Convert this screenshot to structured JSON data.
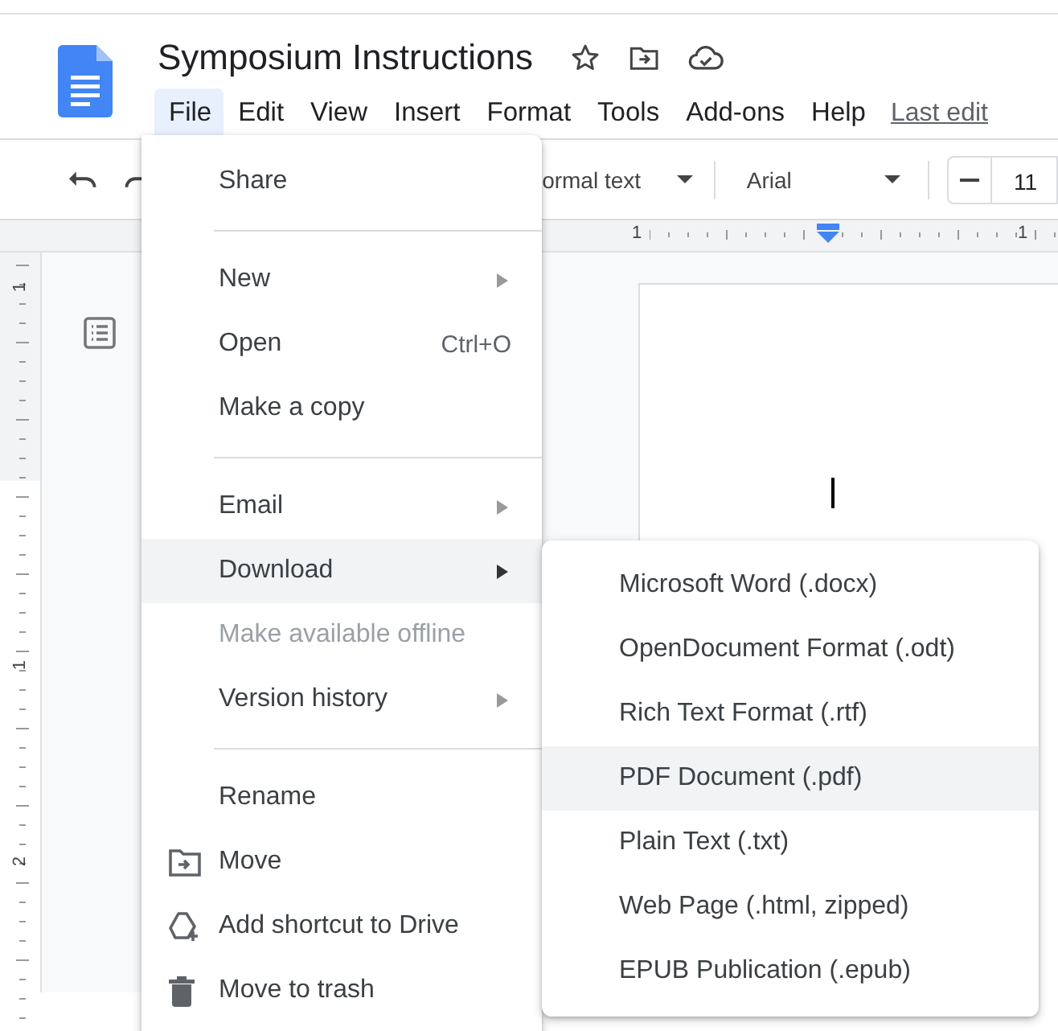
{
  "document": {
    "title": "Symposium Instructions"
  },
  "menu_bar": [
    {
      "label": "File",
      "selected": true
    },
    {
      "label": "Edit",
      "selected": false
    },
    {
      "label": "View",
      "selected": false
    },
    {
      "label": "Insert",
      "selected": false
    },
    {
      "label": "Format",
      "selected": false
    },
    {
      "label": "Tools",
      "selected": false
    },
    {
      "label": "Add-ons",
      "selected": false
    },
    {
      "label": "Help",
      "selected": false
    }
  ],
  "last_edit": "Last edit",
  "toolbar": {
    "paragraph_style": "ormal text",
    "font": "Arial",
    "font_size": "11"
  },
  "ruler_numbers": [
    "1",
    "1"
  ],
  "side_ruler_numbers": [
    "1",
    "1",
    "2"
  ],
  "file_menu": [
    {
      "kind": "plain",
      "label": "Share",
      "submenu": false,
      "disabled": false,
      "selected": false
    },
    {
      "kind": "separator"
    },
    {
      "kind": "plain",
      "label": "New",
      "submenu": true,
      "disabled": false,
      "selected": false
    },
    {
      "kind": "plain",
      "label": "Open",
      "shortcut": "Ctrl+O",
      "submenu": false,
      "disabled": false,
      "selected": false
    },
    {
      "kind": "plain",
      "label": "Make a copy",
      "submenu": false,
      "disabled": false,
      "selected": false
    },
    {
      "kind": "separator"
    },
    {
      "kind": "plain",
      "label": "Email",
      "submenu": true,
      "disabled": false,
      "selected": false
    },
    {
      "kind": "plain",
      "label": "Download",
      "submenu": true,
      "disabled": false,
      "selected": true
    },
    {
      "kind": "plain",
      "label": "Make available offline",
      "submenu": false,
      "disabled": true,
      "selected": false
    },
    {
      "kind": "plain",
      "label": "Version history",
      "submenu": true,
      "disabled": false,
      "selected": false
    },
    {
      "kind": "separator"
    },
    {
      "kind": "plain",
      "label": "Rename",
      "submenu": false,
      "disabled": false,
      "selected": false
    },
    {
      "kind": "folder",
      "label": "Move",
      "submenu": false,
      "disabled": false,
      "selected": false
    },
    {
      "kind": "shortcut",
      "label": "Add shortcut to Drive",
      "submenu": false,
      "disabled": false,
      "selected": false
    },
    {
      "kind": "trash",
      "label": "Move to trash",
      "submenu": false,
      "disabled": false,
      "selected": false
    }
  ],
  "download_menu": [
    {
      "label": "Microsoft Word (.docx)",
      "selected": false
    },
    {
      "label": "OpenDocument Format (.odt)",
      "selected": false
    },
    {
      "label": "Rich Text Format (.rtf)",
      "selected": false
    },
    {
      "label": "PDF Document (.pdf)",
      "selected": true
    },
    {
      "label": "Plain Text (.txt)",
      "selected": false
    },
    {
      "label": "Web Page (.html, zipped)",
      "selected": false
    },
    {
      "label": "EPUB Publication (.epub)",
      "selected": false
    }
  ]
}
